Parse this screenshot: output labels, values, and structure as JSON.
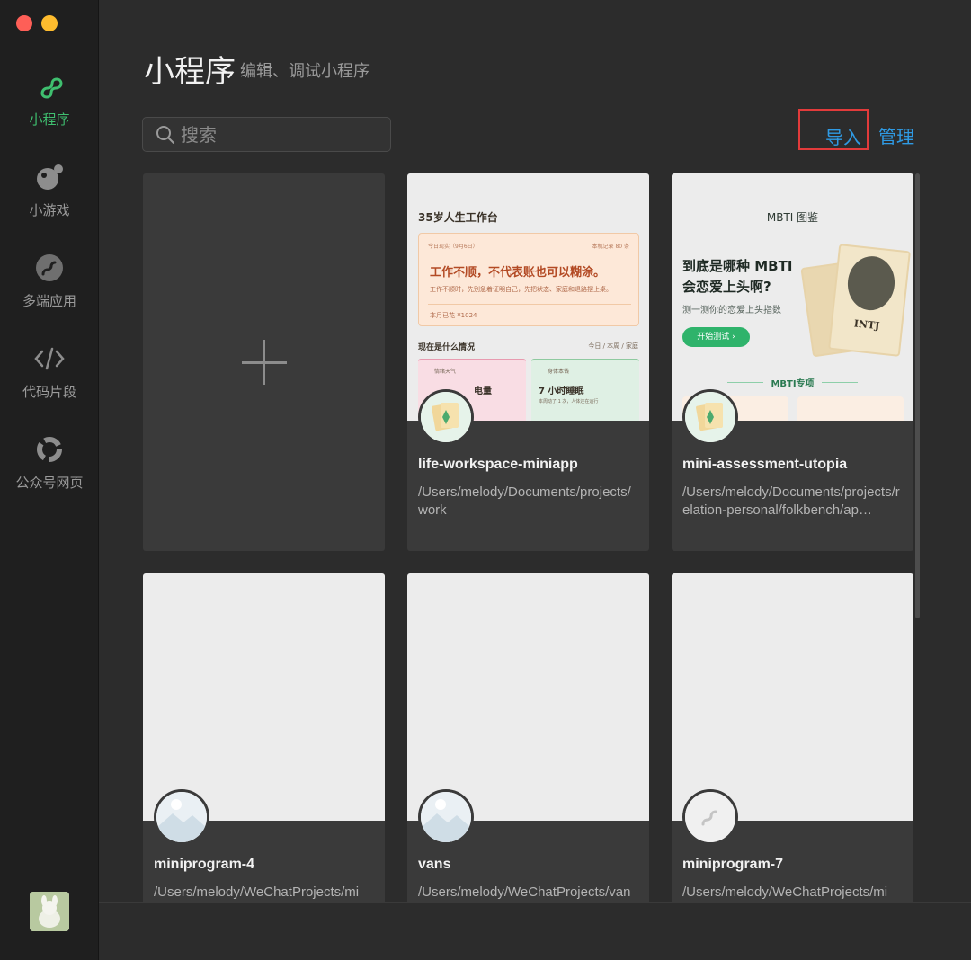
{
  "sidebar": {
    "items": [
      {
        "label": "小程序",
        "icon": "miniprogram-icon",
        "active": true
      },
      {
        "label": "小游戏",
        "icon": "minigame-icon",
        "active": false
      },
      {
        "label": "多端应用",
        "icon": "multiplatform-icon",
        "active": false
      },
      {
        "label": "代码片段",
        "icon": "code-icon",
        "active": false
      },
      {
        "label": "公众号网页",
        "icon": "webpage-icon",
        "active": false
      }
    ],
    "active_color": "#3fbf6f"
  },
  "header": {
    "title": "小程序",
    "subtitle": "编辑、调试小程序"
  },
  "search": {
    "placeholder": "搜索"
  },
  "actions": {
    "import_label": "导入",
    "manage_label": "管理",
    "link_color": "#2f9ae3",
    "highlight_color": "#e23b3b"
  },
  "projects": [
    {
      "name": "life-workspace-miniapp",
      "path": "/Users/melody/Documents/projects/work"
    },
    {
      "name": "mini-assessment-utopia",
      "path": "/Users/melody/Documents/projects/relation-personal/folkbench/ap…"
    },
    {
      "name": "miniprogram-4",
      "path": "/Users/melody/WeChatProjects/mi"
    },
    {
      "name": "vans",
      "path": "/Users/melody/WeChatProjects/van"
    },
    {
      "name": "miniprogram-7",
      "path": "/Users/melody/WeChatProjects/mi"
    }
  ],
  "thumb_life": {
    "heading": "35岁人生工作台",
    "tag": "今日现实（9月6日）",
    "tag2": "本机记录 80 条",
    "headline": "工作不顺，不代表账也可以糊涂。",
    "note": "工作不顺时，先别急着证明自己，先把状态、家庭和退路摆上桌。",
    "foot": "本月已花 ¥1024",
    "section": "现在是什么情况",
    "section_right": "今日 / 本周 / 家庭",
    "tile1_cap": "情绪天气",
    "tile1_big": "电量",
    "tile2_cap": "身体本钱",
    "tile2_big": "7 小时睡眠",
    "tile2_small": "本周动了 1 次，人体还在运行"
  },
  "thumb_mbti": {
    "heading": "MBTI 图鉴",
    "question": "到底是哪种 MBTI 会恋爱上头啊?",
    "sub": "测一测你的恋爱上头指数",
    "button": "开始测试 ›",
    "card_label": "INTJ",
    "section": "MBTI专项"
  }
}
